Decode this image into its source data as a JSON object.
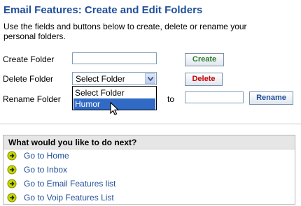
{
  "page": {
    "title": "Email Features: Create and Edit Folders",
    "intro": "Use the fields and buttons below to create, delete or rename your personal folders."
  },
  "form": {
    "create_label": "Create Folder",
    "create_value": "",
    "create_button": "Create",
    "delete_label": "Delete Folder",
    "delete_selected": "Select Folder",
    "delete_options": [
      "Select Folder",
      "Humor"
    ],
    "delete_highlighted": "Humor",
    "delete_button": "Delete",
    "rename_label": "Rename Folder",
    "rename_to": "to",
    "rename_value": "",
    "rename_button": "Rename"
  },
  "next": {
    "heading": "What would you like to do next?",
    "links": [
      "Go to Home",
      "Go to Inbox",
      "Go to Email Features list",
      "Go to Voip Features List"
    ]
  },
  "colors": {
    "title": "#1f4f99",
    "create_button_text": "#2c7a2c",
    "delete_button_text": "#cc0000",
    "rename_button_text": "#1f4f99",
    "highlight": "#316ac5",
    "bullet": "#c8d600"
  },
  "icons": {
    "bullet": "arrow-circle-bullet-icon",
    "dropdown": "chevron-down-icon",
    "cursor": "mouse-pointer-icon"
  }
}
